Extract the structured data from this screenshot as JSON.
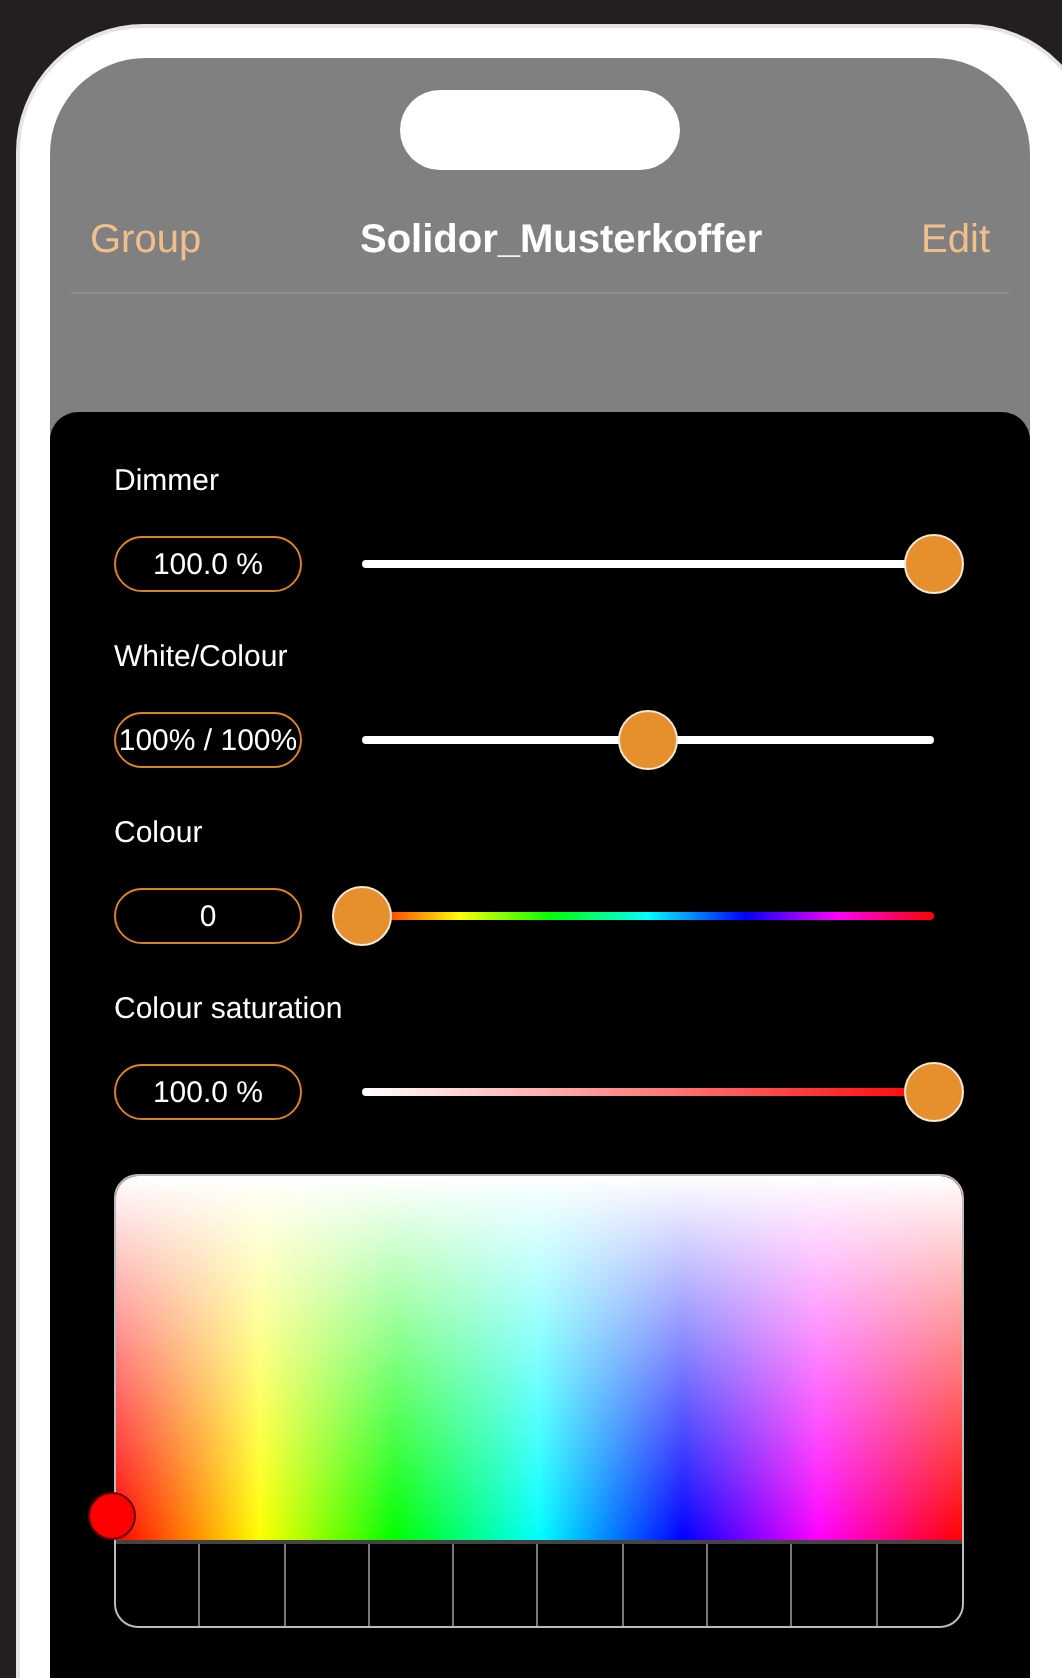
{
  "nav": {
    "back": "Group",
    "title": "Solidor_Musterkoffer",
    "action": "Edit"
  },
  "controls": [
    {
      "label": "Dimmer",
      "value": "100.0 %",
      "kind": "plain",
      "level": 1
    },
    {
      "label": "White/Colour",
      "value": "100% / 100%",
      "kind": "plain",
      "level": 0.5
    },
    {
      "label": "Colour",
      "value": "0",
      "kind": "hue",
      "level": 0
    },
    {
      "label": "Colour saturation",
      "value": "100.0 %",
      "kind": "saturation",
      "level": 1
    }
  ]
}
